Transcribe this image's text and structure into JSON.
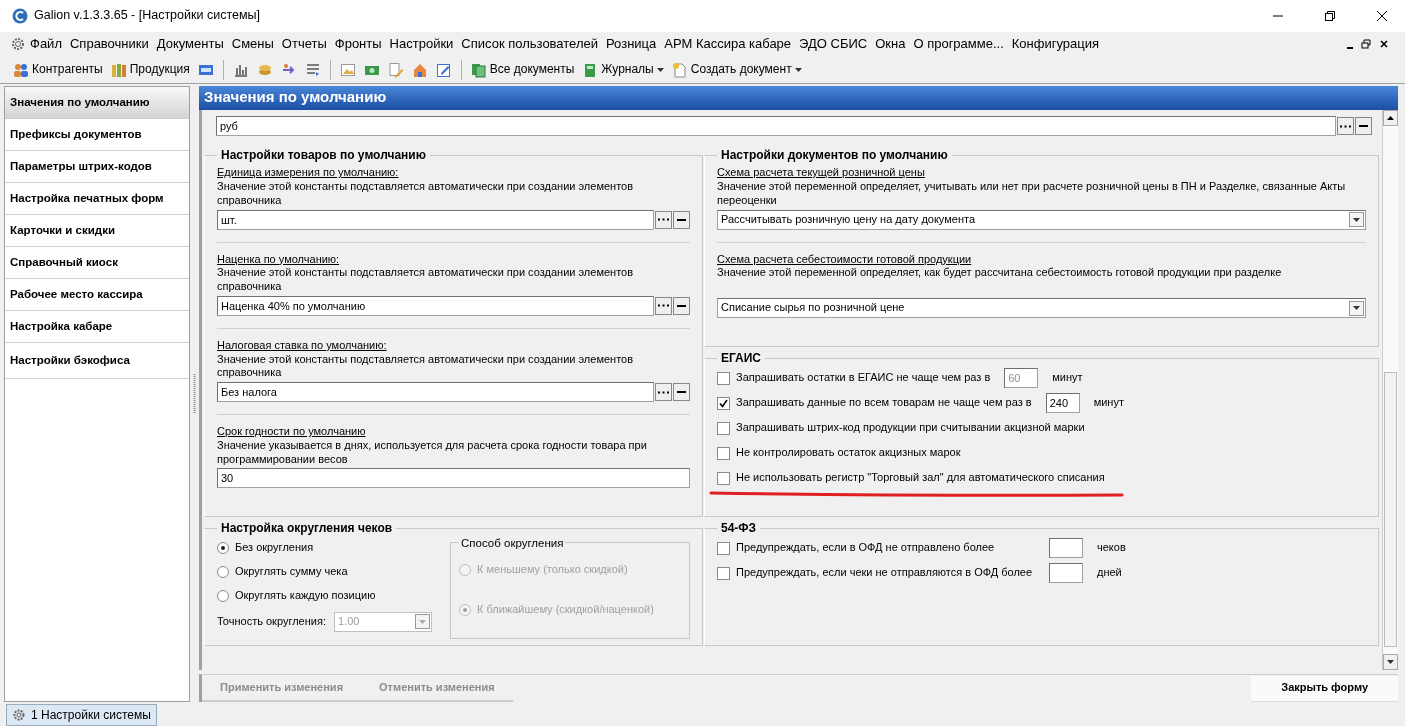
{
  "window": {
    "title": "Galion  v.1.3.3.65  - [Настройки системы]"
  },
  "menu": [
    "Файл",
    "Справочники",
    "Документы",
    "Смены",
    "Отчеты",
    "Фронты",
    "Настройки",
    "Список пользователей",
    "Розница",
    "АРМ Кассира кабаре",
    "ЭДО СБИС",
    "Окна",
    "О программе...",
    "Конфигурация"
  ],
  "toolbar": [
    {
      "label": "Контрагенты",
      "dropdown": false
    },
    {
      "label": "Продукция",
      "dropdown": false
    },
    {
      "label": "Все документы",
      "dropdown": false
    },
    {
      "label": "Журналы",
      "dropdown": true
    },
    {
      "label": "Создать документ",
      "dropdown": true
    }
  ],
  "sidebar": {
    "items": [
      {
        "label": "Значения по умолчанию",
        "selected": true
      },
      {
        "label": "Префиксы документов",
        "selected": false
      },
      {
        "label": "Параметры штрих-кодов",
        "selected": false
      },
      {
        "label": "Настройка печатных форм",
        "selected": false
      },
      {
        "label": "Карточки и скидки",
        "selected": false
      },
      {
        "label": "Справочный киоск",
        "selected": false
      },
      {
        "label": "Рабочее место кассира",
        "selected": false
      },
      {
        "label": "Настройка кабаре",
        "selected": false
      },
      {
        "label": "Настройки бэкофиса",
        "selected": false
      }
    ]
  },
  "form": {
    "title": "Значения по умолчанию",
    "currency_field": {
      "value": "руб"
    },
    "goods_defaults": {
      "title": "Настройки товаров по умолчанию",
      "settings": [
        {
          "kind": "picker",
          "label": "Единица измерения по умолчанию:",
          "description": "Значение этой константы подставляется автоматически при создании элементов справочника",
          "value": "шт."
        },
        {
          "kind": "picker",
          "label": "Наценка по умолчанию:",
          "description": "Значение этой константы подставляется автоматически при создании элементов справочника",
          "value": "Наценка 40% по умолчанию"
        },
        {
          "kind": "picker",
          "label": "Налоговая ставка по умолчанию:",
          "description": "Значение этой константы подставляется автоматически при создании элементов справочника",
          "value": "Без налога"
        },
        {
          "kind": "text",
          "label": "Срок годности по умолчанию",
          "description": "Значение указывается в днях, используется для расчета срока годности товара при программировании весов",
          "value": "30"
        }
      ]
    },
    "document_defaults": {
      "title": "Настройки документов по умолчанию",
      "settings": [
        {
          "kind": "select",
          "label": "Схема расчета текущей розничной цены",
          "description": "Значение этой переменной определяет, учитывать или нет при расчете розничной цены в ПН и Разделке, связанные Акты переоценки",
          "value": "Рассчитывать розничную цену на дату документа"
        },
        {
          "kind": "select",
          "label": "Схема расчета себестоимости готовой продукции",
          "description": "Значение этой переменной определяет, как будет рассчитана себестоимость готовой продукции при разделке",
          "value": "Списание сырья по розничной цене"
        }
      ]
    },
    "egais": {
      "title": "ЕГАИС",
      "options": [
        {
          "kind": "field",
          "label": "Запрашивать остатки в ЕГАИС не чаще чем раз в",
          "value": "60",
          "field_disabled": true,
          "unit": "минут",
          "checked": false
        },
        {
          "kind": "field",
          "label": "Запрашивать данные по всем товарам не чаще чем раз в",
          "value": "240",
          "field_disabled": false,
          "unit": "минут",
          "checked": true
        },
        {
          "kind": "plain",
          "label": "Запрашивать штрих-код продукции при считывании акцизной марки",
          "checked": false
        },
        {
          "kind": "plain",
          "label": "Не контролировать остаток акцизных марок",
          "checked": false
        },
        {
          "kind": "plain",
          "label": "Не использовать регистр \"Торговый зал\" для автоматического списания",
          "checked": false
        }
      ]
    },
    "rounding": {
      "title": "Настройка округления чеков",
      "modes": [
        {
          "label": "Без округления",
          "selected": true
        },
        {
          "label": "Округлять сумму чека",
          "selected": false
        },
        {
          "label": "Округлять каждую позицию",
          "selected": false
        }
      ],
      "precision": {
        "label": "Точность округления:",
        "value": "1.00",
        "disabled": true
      },
      "method": {
        "title": "Способ округления",
        "disabled": true,
        "options": [
          {
            "label": "К меньшему (только скидкой)",
            "selected": false
          },
          {
            "label": "К ближайшему (скидкой/наценкой)",
            "selected": true
          }
        ]
      }
    },
    "fz54": {
      "title": "54-ФЗ",
      "options": [
        {
          "kind": "field",
          "label": "Предупреждать, если в ОФД не отправлено более",
          "unit": "чеков",
          "checked": false
        },
        {
          "kind": "field",
          "label": "Предупреждать, если чеки не отправляются в ОФД более",
          "unit": "дней",
          "checked": false
        }
      ]
    },
    "buttons": [
      {
        "label": "Применить изменения",
        "disabled": true
      },
      {
        "label": "Отменить изменения",
        "disabled": true
      },
      {
        "label": "Закрыть форму",
        "disabled": false
      }
    ]
  },
  "taskbar": {
    "items": [
      {
        "label": "1 Настройки системы"
      }
    ]
  }
}
